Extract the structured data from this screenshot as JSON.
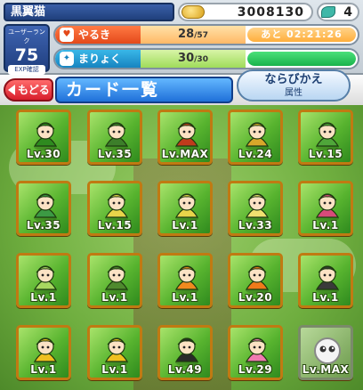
{
  "player": {
    "name": "黒翼猫"
  },
  "currency": {
    "coins": "3008130",
    "gems": "4"
  },
  "rank": {
    "label": "ユーザーランク",
    "value": "75",
    "exp_label": "EXP確認"
  },
  "stamina": {
    "label": "やるき",
    "current": "28",
    "max": "/57",
    "timer": "あと 02:21:26",
    "icon": "heart-icon"
  },
  "magic": {
    "label": "まりょく",
    "current": "30",
    "max": "/30",
    "fill_fraction": 1.0,
    "icon": "magic-icon"
  },
  "header": {
    "back_label": "もどる",
    "title": "カード一覧",
    "sort_label": "ならびかえ",
    "sort_sub": "属性"
  },
  "cards": [
    {
      "level": "Lv.30",
      "art": "dragon-icon",
      "color": "#2e8a1f"
    },
    {
      "level": "Lv.35",
      "art": "dragon-icon",
      "color": "#3c7e2a"
    },
    {
      "level": "Lv.MAX",
      "art": "warrior-icon",
      "color": "#c03a1c"
    },
    {
      "level": "Lv.24",
      "art": "warrior-icon",
      "color": "#d8a72a"
    },
    {
      "level": "Lv.15",
      "art": "frog-icon",
      "color": "#4fa63a"
    },
    {
      "level": "Lv.35",
      "art": "girl-icon",
      "color": "#3c9a44"
    },
    {
      "level": "Lv.15",
      "art": "boy-icon",
      "color": "#e8d44a"
    },
    {
      "level": "Lv.1",
      "art": "boy-icon",
      "color": "#e8d44a"
    },
    {
      "level": "Lv.33",
      "art": "boy-icon",
      "color": "#f0e070"
    },
    {
      "level": "Lv.1",
      "art": "fairy-icon",
      "color": "#d84a7a"
    },
    {
      "level": "Lv.1",
      "art": "witch-icon",
      "color": "#a8d860"
    },
    {
      "level": "Lv.1",
      "art": "monster-icon",
      "color": "#4f8a2e"
    },
    {
      "level": "Lv.1",
      "art": "pumpkin-icon",
      "color": "#f08a1e"
    },
    {
      "level": "Lv.20",
      "art": "pumpkin-icon",
      "color": "#f07a1a"
    },
    {
      "level": "Lv.1",
      "art": "witch-icon",
      "color": "#3a3a3a"
    },
    {
      "level": "Lv.1",
      "art": "witch-icon",
      "color": "#f0c020"
    },
    {
      "level": "Lv.1",
      "art": "witch-icon",
      "color": "#f0c020"
    },
    {
      "level": "Lv.49",
      "art": "witch-icon",
      "color": "#2a2a2a"
    },
    {
      "level": "Lv.29",
      "art": "girl-icon",
      "color": "#f07ab0"
    },
    {
      "level": "Lv.MAX",
      "art": "puyo-icon",
      "color": "#ffffff",
      "empty": true
    }
  ]
}
